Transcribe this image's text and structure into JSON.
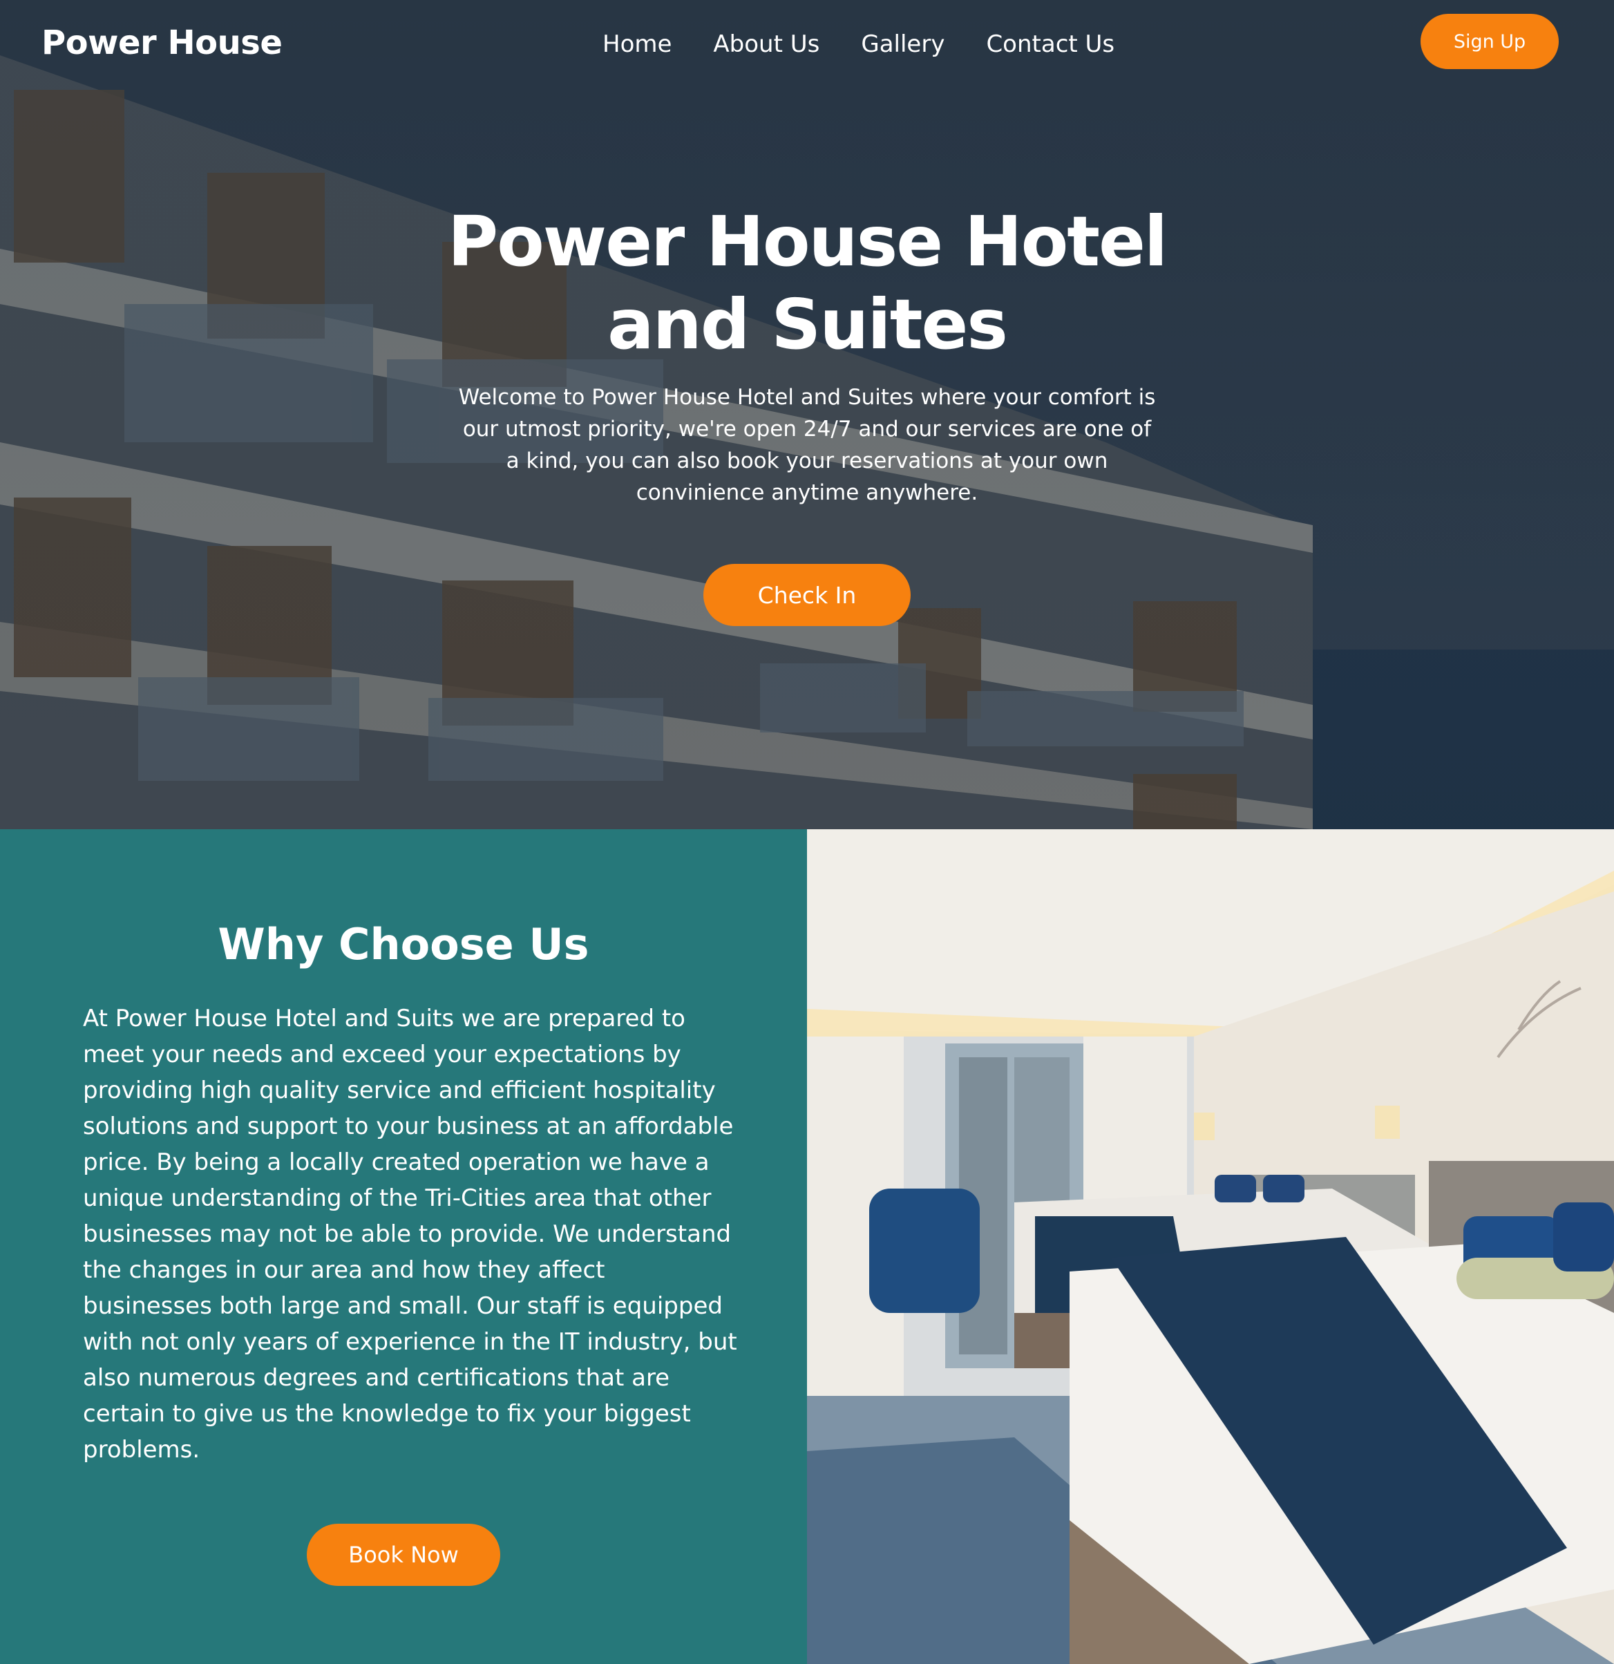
{
  "nav": {
    "logo": "Power House",
    "links": [
      "Home",
      "About Us",
      "Gallery",
      "Contact Us"
    ],
    "signup_label": "Sign Up"
  },
  "hero": {
    "title": "Power House Hotel and Suites",
    "text": "Welcome to Power House Hotel and Suites where your comfort is our utmost priority, we're open 24/7 and our services are one of a kind, you can also book your reservations at your own convinience anytime anywhere.",
    "cta_label": "Check In"
  },
  "why": {
    "title": "Why Choose Us",
    "text": "At Power House Hotel and Suits we are prepared to meet your needs and exceed your expectations by providing high quality service and efficient hospitality solutions and support to your business at an affordable price. By being a locally created operation we have a unique understanding of the Tri-Cities area that other businesses may not be able to provide. We understand the changes in our area and how they affect businesses both large and small. Our staff is equipped with not only years of experience in the IT industry, but also numerous degrees and certifications that are certain to give us the knowledge to fix your biggest problems.",
    "cta_label": "Book Now"
  },
  "colors": {
    "accent": "#f7810f",
    "teal": "#26787a",
    "hero_overlay": "#2b3a4b"
  }
}
